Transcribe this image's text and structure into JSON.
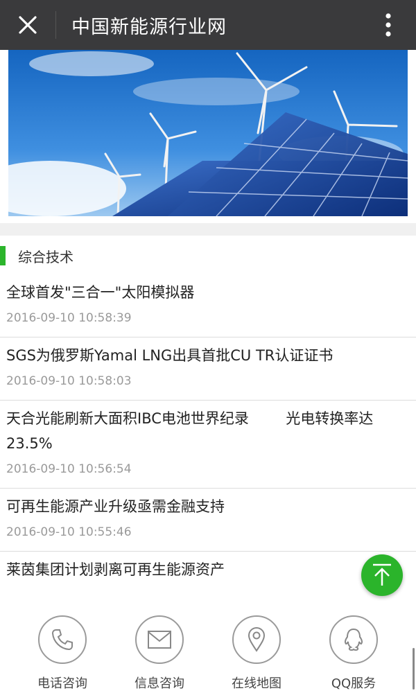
{
  "window": {
    "title": "中国新能源行业网",
    "close_icon": "close-icon",
    "more_icon": "more-vertical-icon",
    "bar_color": "#3a3a3c"
  },
  "banner": {
    "description_icon": "solar-wind-banner-image"
  },
  "section": {
    "title": "综合技术",
    "accent_color": "#2cb52c"
  },
  "news": [
    {
      "title": "全球首发\"三合一\"太阳模拟器",
      "time": "2016-09-10 10:58:39"
    },
    {
      "title": "SGS为俄罗斯Yamal LNG出具首批CU TR认证证书",
      "time": "2016-09-10 10:58:03"
    },
    {
      "title": "天合光能刷新大面积IBC电池世界纪录        光电转换率达23.5%",
      "time": "2016-09-10 10:56:54"
    },
    {
      "title": "可再生能源产业升级亟需金融支持",
      "time": "2016-09-10 10:55:46"
    },
    {
      "title": "莱茵集团计划剥离可再生能源资产",
      "time": ""
    }
  ],
  "back_to_top": {
    "icon": "arrow-up-icon",
    "color": "#2bb42b"
  },
  "bottom_bar": {
    "items": [
      {
        "label": "电话咨询",
        "icon": "phone-icon"
      },
      {
        "label": "信息咨询",
        "icon": "envelope-icon"
      },
      {
        "label": "在线地图",
        "icon": "map-pin-icon"
      },
      {
        "label": "QQ服务",
        "icon": "qq-icon"
      }
    ]
  }
}
